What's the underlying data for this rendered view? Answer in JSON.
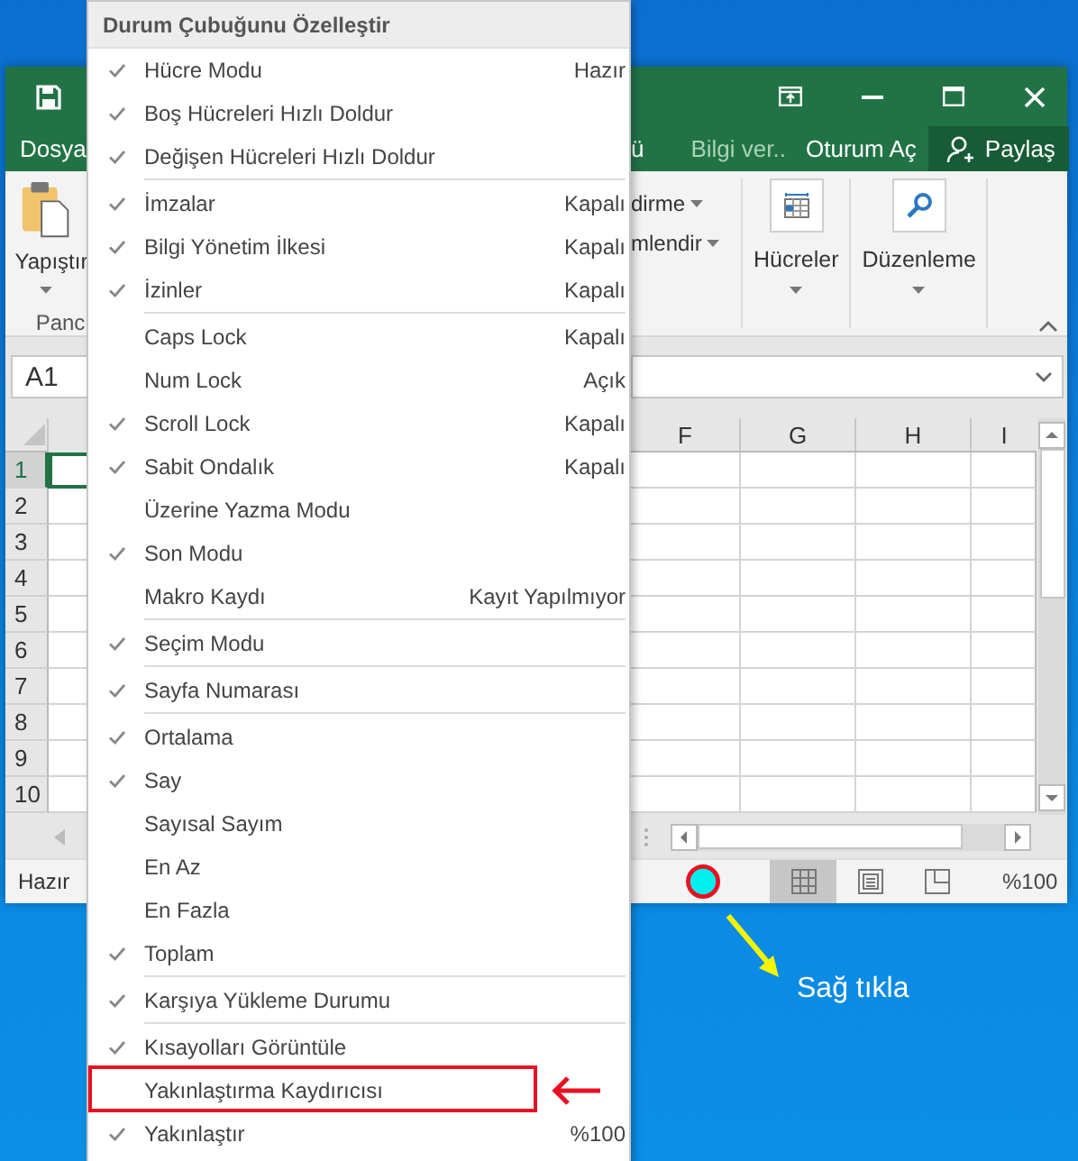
{
  "excel": {
    "file_tab": "Dosya",
    "tabs_right": [
      {
        "kind": "fragment",
        "label": "ü"
      },
      {
        "kind": "tell_me",
        "label": "Bilgi ver.."
      },
      {
        "kind": "plain",
        "label": "Oturum Aç"
      }
    ],
    "share": "Paylaş",
    "paste_label": "Yapıştır",
    "group_label": "Panc",
    "ribbon_fragments": [
      "dirme",
      "mlendir"
    ],
    "ribbon_groups": [
      {
        "kind": "cells",
        "label": "Hücreler"
      },
      {
        "kind": "editing",
        "label": "Düzenleme"
      }
    ],
    "name_box": "A1",
    "columns": [
      "F",
      "G",
      "H",
      "I"
    ],
    "rows": [
      "1",
      "2",
      "3",
      "4",
      "5",
      "6",
      "7",
      "8",
      "9",
      "10"
    ],
    "status": "Hazır",
    "views": [
      {
        "kind": "normal",
        "selected": true
      },
      {
        "kind": "page_layout",
        "selected": false
      },
      {
        "kind": "page_break",
        "selected": false
      }
    ],
    "zoom": "%100"
  },
  "menu": {
    "title": "Durum Çubuğunu Özelleştir",
    "items": [
      {
        "label": "Hücre Modu",
        "checked": true,
        "value": "Hazır",
        "separator_after": false,
        "highlighted": false
      },
      {
        "label": "Boş Hücreleri Hızlı Doldur",
        "checked": true,
        "separator_after": false,
        "highlighted": false
      },
      {
        "label": "Değişen Hücreleri Hızlı Doldur",
        "checked": true,
        "separator_after": true,
        "highlighted": false
      },
      {
        "label": "İmzalar",
        "checked": true,
        "value": "Kapalı",
        "separator_after": false,
        "highlighted": false
      },
      {
        "label": "Bilgi Yönetim İlkesi",
        "checked": true,
        "value": "Kapalı",
        "separator_after": false,
        "highlighted": false
      },
      {
        "label": "İzinler",
        "checked": true,
        "value": "Kapalı",
        "separator_after": true,
        "highlighted": false
      },
      {
        "label": "Caps Lock",
        "checked": false,
        "value": "Kapalı",
        "separator_after": false,
        "highlighted": false
      },
      {
        "label": "Num Lock",
        "checked": false,
        "value": "Açık",
        "separator_after": false,
        "highlighted": false
      },
      {
        "label": "Scroll Lock",
        "checked": true,
        "value": "Kapalı",
        "separator_after": false,
        "highlighted": false
      },
      {
        "label": "Sabit Ondalık",
        "checked": true,
        "value": "Kapalı",
        "separator_after": false,
        "highlighted": false
      },
      {
        "label": "Üzerine Yazma Modu",
        "checked": false,
        "separator_after": false,
        "highlighted": false
      },
      {
        "label": "Son Modu",
        "checked": true,
        "separator_after": false,
        "highlighted": false
      },
      {
        "label": "Makro Kaydı",
        "checked": false,
        "value": "Kayıt Yapılmıyor",
        "separator_after": true,
        "highlighted": false
      },
      {
        "label": "Seçim Modu",
        "checked": true,
        "separator_after": true,
        "highlighted": false
      },
      {
        "label": "Sayfa Numarası",
        "checked": true,
        "separator_after": true,
        "highlighted": false
      },
      {
        "label": "Ortalama",
        "checked": true,
        "separator_after": false,
        "highlighted": false
      },
      {
        "label": "Say",
        "checked": true,
        "separator_after": false,
        "highlighted": false
      },
      {
        "label": "Sayısal Sayım",
        "checked": false,
        "separator_after": false,
        "highlighted": false
      },
      {
        "label": "En Az",
        "checked": false,
        "separator_after": false,
        "highlighted": false
      },
      {
        "label": "En Fazla",
        "checked": false,
        "separator_after": false,
        "highlighted": false
      },
      {
        "label": "Toplam",
        "checked": true,
        "separator_after": true,
        "highlighted": false
      },
      {
        "label": "Karşıya Yükleme Durumu",
        "checked": true,
        "separator_after": true,
        "highlighted": false
      },
      {
        "label": "Kısayolları Görüntüle",
        "checked": true,
        "separator_after": false,
        "highlighted": false
      },
      {
        "label": "Yakınlaştırma Kaydırıcısı",
        "checked": false,
        "separator_after": false,
        "highlighted": true
      },
      {
        "label": "Yakınlaştır",
        "checked": true,
        "value": "%100",
        "separator_after": false,
        "highlighted": false
      }
    ]
  },
  "callout": "Sağ tıkla"
}
